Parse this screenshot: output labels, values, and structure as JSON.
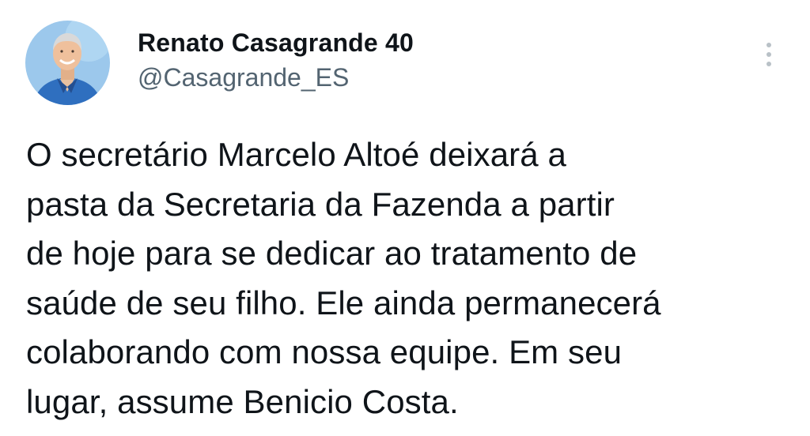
{
  "author": {
    "display_name": "Renato Casagrande 40",
    "handle": "@Casagrande_ES"
  },
  "avatar": {
    "icon": "profile-photo",
    "background_color": "#9cc8ec",
    "shirt_color": "#2f6fbf"
  },
  "menu": {
    "icon": "more-vertical-icon"
  },
  "tweet": {
    "lines": [
      "O secretário Marcelo Altoé deixará a",
      "pasta da Secretaria da Fazenda a partir",
      "de hoje para se dedicar ao tratamento de",
      "saúde de seu filho. Ele ainda permanecerá",
      "colaborando com nossa equipe. Em seu",
      "lugar, assume Benicio Costa."
    ]
  },
  "colors": {
    "text": "#0f1419",
    "secondary_text": "#536471",
    "icon_gray": "#b9c1c7"
  }
}
